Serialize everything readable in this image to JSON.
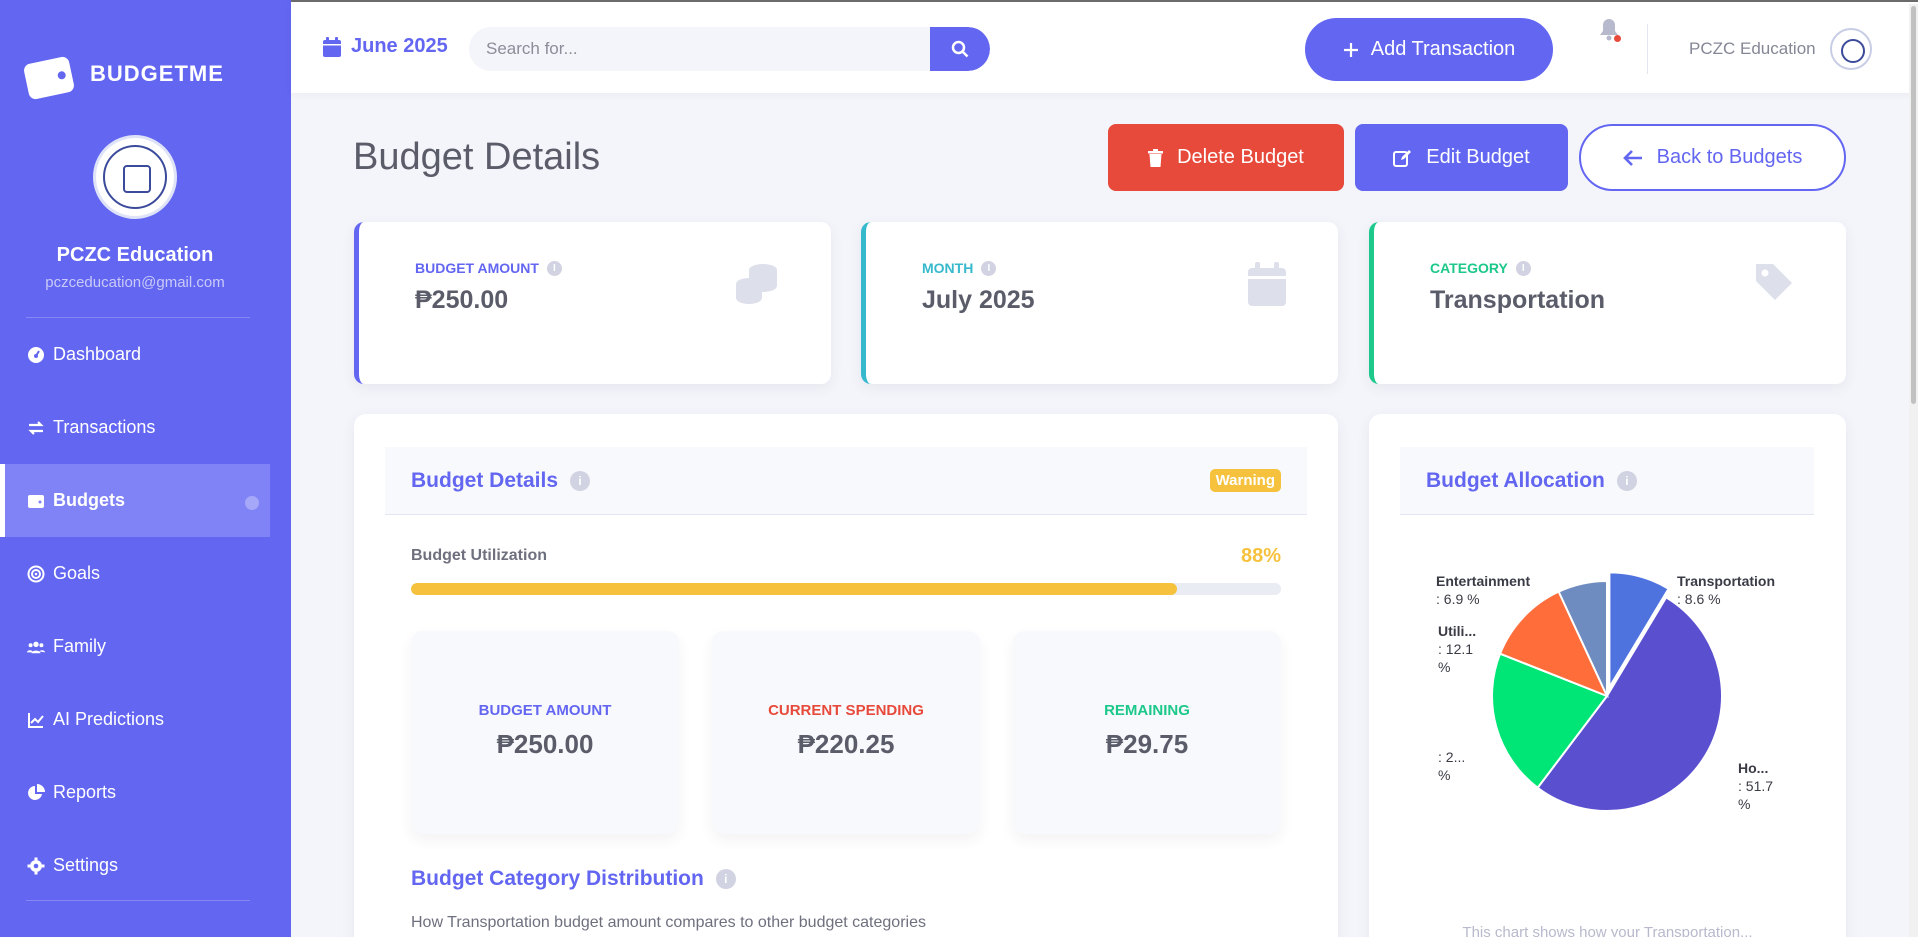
{
  "brand": {
    "name": "BUDGETME"
  },
  "profile": {
    "name": "PCZC Education",
    "email": "pczceducation@gmail.com"
  },
  "sidebar": {
    "items": [
      {
        "label": "Dashboard",
        "icon": "gauge-icon"
      },
      {
        "label": "Transactions",
        "icon": "exchange-icon"
      },
      {
        "label": "Budgets",
        "icon": "wallet-icon",
        "active": true
      },
      {
        "label": "Goals",
        "icon": "target-icon"
      },
      {
        "label": "Family",
        "icon": "users-icon"
      },
      {
        "label": "AI Predictions",
        "icon": "line-chart-icon"
      },
      {
        "label": "Reports",
        "icon": "pie-chart-icon"
      },
      {
        "label": "Settings",
        "icon": "gear-icon"
      }
    ]
  },
  "topbar": {
    "date": "June 2025",
    "search_placeholder": "Search for...",
    "add_label": "Add Transaction",
    "user_name": "PCZC Education"
  },
  "page": {
    "title": "Budget Details",
    "delete_label": "Delete Budget",
    "edit_label": "Edit Budget",
    "back_label": "Back to Budgets"
  },
  "stats": {
    "amount": {
      "label": "BUDGET AMOUNT",
      "value": "₱250.00"
    },
    "month": {
      "label": "MONTH",
      "value": "July 2025"
    },
    "category": {
      "label": "CATEGORY",
      "value": "Transportation"
    }
  },
  "details": {
    "title": "Budget Details",
    "badge": "Warning",
    "util_label": "Budget Utilization",
    "util_pct": "88%",
    "util_value": 0.88,
    "cards": [
      {
        "label": "BUDGET AMOUNT",
        "value": "₱250.00",
        "color": "#6366f1"
      },
      {
        "label": "CURRENT SPENDING",
        "value": "₱220.25",
        "color": "#e74a3b"
      },
      {
        "label": "REMAINING",
        "value": "₱29.75",
        "color": "#1cc88a"
      }
    ],
    "dist_title": "Budget Category Distribution",
    "dist_sub": "How Transportation budget amount compares to other budget categories"
  },
  "allocation": {
    "title": "Budget Allocation",
    "note": "This chart shows how your Transportation..."
  },
  "chart_data": {
    "type": "pie",
    "slices": [
      {
        "label": "Transportation",
        "display_name": "Transportation",
        "value": 8.6,
        "value_text": ": 8.6 %",
        "color": "#4e73df"
      },
      {
        "label": "Housing",
        "display_name": "Ho...",
        "value": 51.7,
        "value_text": ": 51.7 %",
        "color": "#5a4fcf"
      },
      {
        "label": "",
        "display_name": "",
        "value": 20.7,
        "value_text": ": 2... %",
        "color": "#00e676"
      },
      {
        "label": "Utilities",
        "display_name": "Utili...",
        "value": 12.1,
        "value_text": ": 12.1 %",
        "color": "#ff6d3a"
      },
      {
        "label": "Entertainment",
        "display_name": "Entertainment",
        "value": 6.9,
        "value_text": ": 6.9 %",
        "color": "#6f8cc0"
      }
    ]
  }
}
